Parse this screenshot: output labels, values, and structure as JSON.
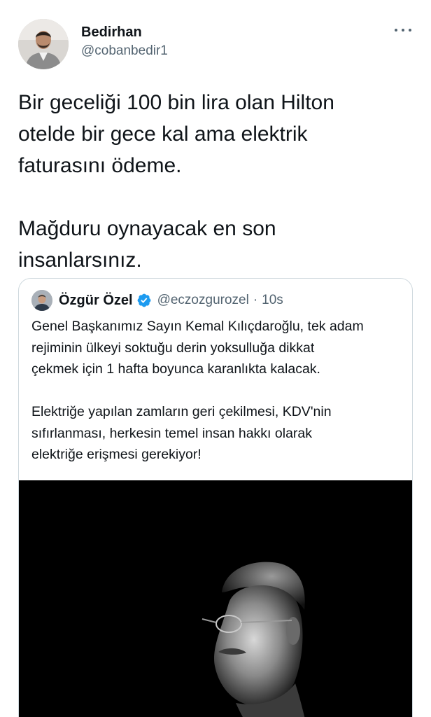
{
  "tweet": {
    "author": {
      "display_name": "Bedirhan",
      "handle": "@cobanbedir1"
    },
    "paragraphs": [
      "Bir geceliği 100 bin lira olan Hilton\notelde bir gece kal ama elektrik\nfaturasını ödeme.",
      "Mağduru oynayacak en son\ninsanlarsınız."
    ],
    "more_icon": "more-horizontal-icon"
  },
  "quoted_tweet": {
    "author": {
      "display_name": "Özgür Özel",
      "handle": "@eczozgurozel",
      "verified": true
    },
    "separator": "·",
    "time": "10s",
    "paragraphs": [
      "Genel Başkanımız Sayın Kemal Kılıçdaroğlu, tek adam\nrejiminin ülkeyi soktuğu derin yoksulluğa dikkat\nçekmek için 1 hafta boyunca karanlıkta kalacak.",
      "Elektriğe yapılan zamların geri çekilmesi, KDV'nin\nsıfırlanması, herkesin temel insan hakkı olarak\nelektriğe erişmesi gerekiyor!"
    ],
    "media": {
      "description_icon": "portrait-photo",
      "background": "#000000"
    }
  },
  "colors": {
    "text": "#0f1419",
    "secondary": "#536471",
    "border": "#cfd9de",
    "verified": "#1d9bf0"
  }
}
